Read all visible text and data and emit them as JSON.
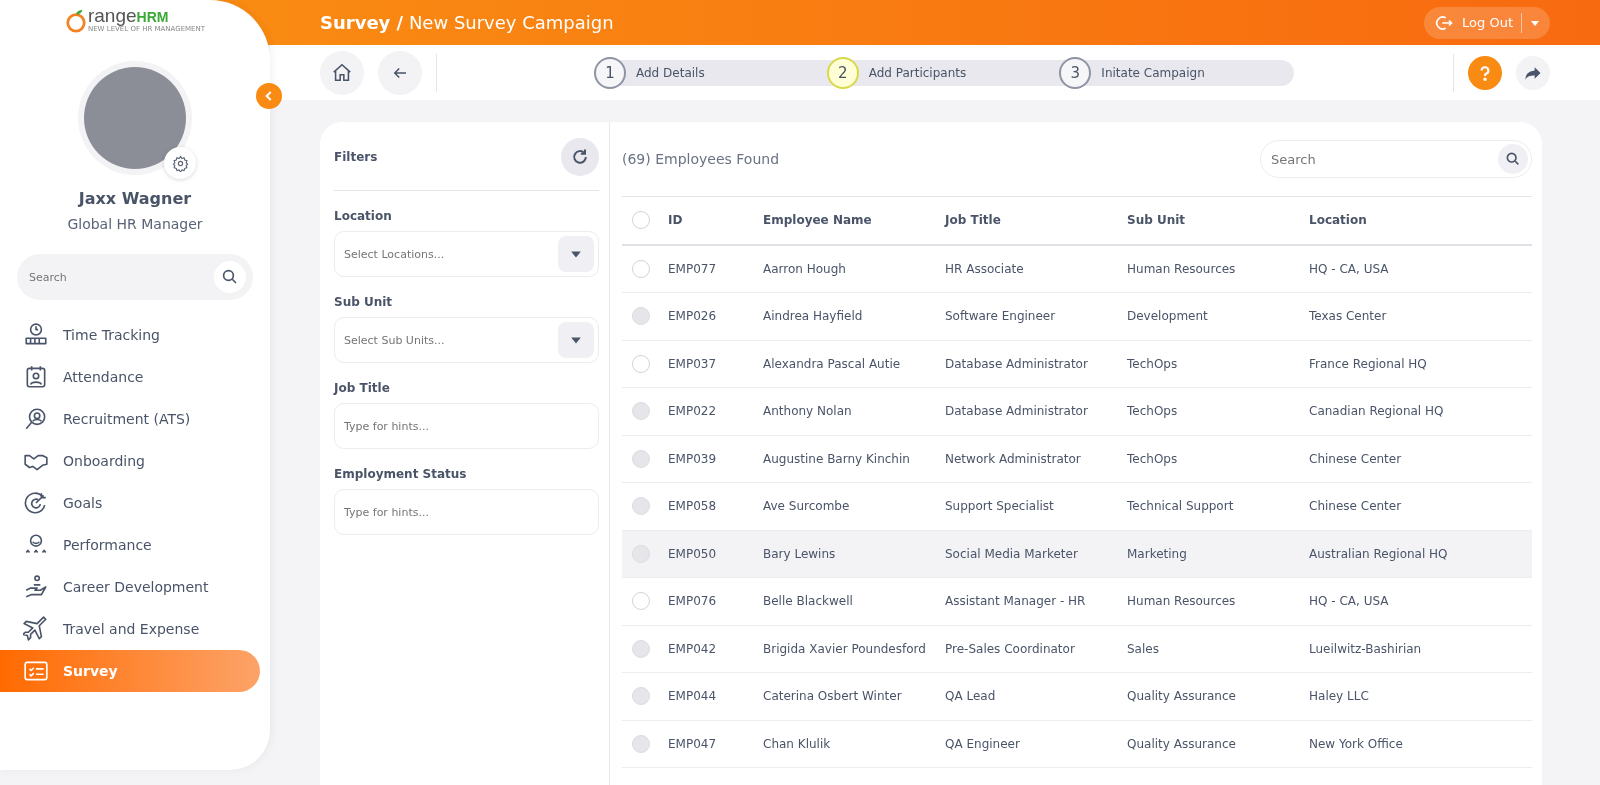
{
  "logo": {
    "brand": "range",
    "brand_suffix": "HRM",
    "tagline": "NEW LEVEL OF HR MANAGEMENT"
  },
  "header": {
    "section": "Survey /",
    "page": "New Survey Campaign",
    "logout": "Log Out"
  },
  "user": {
    "name": "Jaxx Wagner",
    "role": "Global HR Manager"
  },
  "sidebar": {
    "search": {
      "placeholder": "Search"
    },
    "items": [
      {
        "label": "Time Tracking",
        "selected": false
      },
      {
        "label": "Attendance",
        "selected": false
      },
      {
        "label": "Recruitment (ATS)",
        "selected": false
      },
      {
        "label": "Onboarding",
        "selected": false
      },
      {
        "label": "Goals",
        "selected": false
      },
      {
        "label": "Performance",
        "selected": false
      },
      {
        "label": "Career Development",
        "selected": false
      },
      {
        "label": "Travel and Expense",
        "selected": false
      },
      {
        "label": "Survey",
        "selected": true
      }
    ]
  },
  "steps": [
    {
      "number": "1",
      "label": "Add Details",
      "selected": false
    },
    {
      "number": "2",
      "label": "Add Participants",
      "selected": true
    },
    {
      "number": "3",
      "label": "Initate Campaign",
      "selected": false
    }
  ],
  "filters": {
    "title": "Filters",
    "fields": [
      {
        "label": "Location",
        "kind": "select",
        "placeholder": "Select Locations..."
      },
      {
        "label": "Sub Unit",
        "kind": "select",
        "placeholder": "Select Sub Units..."
      },
      {
        "label": "Job Title",
        "kind": "text",
        "placeholder": "Type for hints..."
      },
      {
        "label": "Employment Status",
        "kind": "text",
        "placeholder": "Type for hints..."
      }
    ]
  },
  "results": {
    "count": "(69) Employees Found",
    "search": {
      "placeholder": "Search"
    }
  },
  "table": {
    "select_all": {
      "checked": false
    },
    "columns": [
      "ID",
      "Employee Name",
      "Job Title",
      "Sub Unit",
      "Location"
    ],
    "rows": [
      {
        "cells": [
          "EMP077",
          "Aarron Hough",
          "HR Associate",
          "Human Resources",
          "HQ - CA, USA"
        ],
        "disabled": false,
        "hovered": false
      },
      {
        "cells": [
          "EMP026",
          "Aindrea Hayfield",
          "Software Engineer",
          "Development",
          "Texas Center"
        ],
        "disabled": true,
        "hovered": false
      },
      {
        "cells": [
          "EMP037",
          "Alexandra Pascal Autie",
          "Database Administrator",
          "TechOps",
          "France Regional HQ"
        ],
        "disabled": false,
        "hovered": false
      },
      {
        "cells": [
          "EMP022",
          "Anthony Nolan",
          "Database Administrator",
          "TechOps",
          "Canadian Regional HQ"
        ],
        "disabled": true,
        "hovered": false
      },
      {
        "cells": [
          "EMP039",
          "Augustine Barny Kinchin",
          "Network Administrator",
          "TechOps",
          "Chinese Center"
        ],
        "disabled": true,
        "hovered": false
      },
      {
        "cells": [
          "EMP058",
          "Ave Surcombe",
          "Support Specialist",
          "Technical Support",
          "Chinese Center"
        ],
        "disabled": true,
        "hovered": false
      },
      {
        "cells": [
          "EMP050",
          "Bary Lewins",
          "Social Media Marketer",
          "Marketing",
          "Australian Regional HQ"
        ],
        "disabled": true,
        "hovered": true
      },
      {
        "cells": [
          "EMP076",
          "Belle Blackwell",
          "Assistant Manager - HR",
          "Human Resources",
          "HQ - CA, USA"
        ],
        "disabled": false,
        "hovered": false
      },
      {
        "cells": [
          "EMP042",
          "Brigida Xavier Poundesford",
          "Pre-Sales Coordinator",
          "Sales",
          "Lueilwitz-Bashirian"
        ],
        "disabled": true,
        "hovered": false
      },
      {
        "cells": [
          "EMP044",
          "Caterina Osbert Winter",
          "QA Lead",
          "Quality Assurance",
          "Haley LLC"
        ],
        "disabled": true,
        "hovered": false
      },
      {
        "cells": [
          "EMP047",
          "Chan Klulik",
          "QA Engineer",
          "Quality Assurance",
          "New York Office"
        ],
        "disabled": true,
        "hovered": false
      }
    ]
  }
}
